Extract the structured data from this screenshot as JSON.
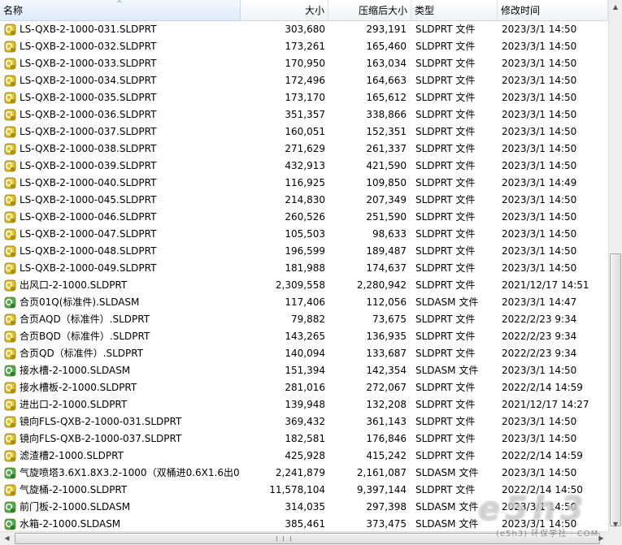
{
  "columns": {
    "name": "名称",
    "size": "大小",
    "compressed_size": "压缩后大小",
    "type": "类型",
    "modified": "修改时间"
  },
  "files": [
    {
      "name": "LS-QXB-2-1000-031.SLDPRT",
      "size": "303,680",
      "compressed": "293,191",
      "type": "SLDPRT 文件",
      "modified": "2023/3/1 14:50",
      "icon": "sldprt-icon"
    },
    {
      "name": "LS-QXB-2-1000-032.SLDPRT",
      "size": "173,261",
      "compressed": "165,460",
      "type": "SLDPRT 文件",
      "modified": "2023/3/1 14:50",
      "icon": "sldprt-icon"
    },
    {
      "name": "LS-QXB-2-1000-033.SLDPRT",
      "size": "170,950",
      "compressed": "163,034",
      "type": "SLDPRT 文件",
      "modified": "2023/3/1 14:50",
      "icon": "sldprt-icon"
    },
    {
      "name": "LS-QXB-2-1000-034.SLDPRT",
      "size": "172,496",
      "compressed": "164,663",
      "type": "SLDPRT 文件",
      "modified": "2023/3/1 14:50",
      "icon": "sldprt-icon"
    },
    {
      "name": "LS-QXB-2-1000-035.SLDPRT",
      "size": "173,170",
      "compressed": "165,612",
      "type": "SLDPRT 文件",
      "modified": "2023/3/1 14:50",
      "icon": "sldprt-icon"
    },
    {
      "name": "LS-QXB-2-1000-036.SLDPRT",
      "size": "351,357",
      "compressed": "338,866",
      "type": "SLDPRT 文件",
      "modified": "2023/3/1 14:50",
      "icon": "sldprt-icon"
    },
    {
      "name": "LS-QXB-2-1000-037.SLDPRT",
      "size": "160,051",
      "compressed": "152,351",
      "type": "SLDPRT 文件",
      "modified": "2023/3/1 14:50",
      "icon": "sldprt-icon"
    },
    {
      "name": "LS-QXB-2-1000-038.SLDPRT",
      "size": "271,629",
      "compressed": "261,337",
      "type": "SLDPRT 文件",
      "modified": "2023/3/1 14:50",
      "icon": "sldprt-icon"
    },
    {
      "name": "LS-QXB-2-1000-039.SLDPRT",
      "size": "432,913",
      "compressed": "421,590",
      "type": "SLDPRT 文件",
      "modified": "2023/3/1 14:50",
      "icon": "sldprt-icon"
    },
    {
      "name": "LS-QXB-2-1000-040.SLDPRT",
      "size": "116,925",
      "compressed": "109,850",
      "type": "SLDPRT 文件",
      "modified": "2023/3/1 14:49",
      "icon": "sldprt-icon"
    },
    {
      "name": "LS-QXB-2-1000-045.SLDPRT",
      "size": "214,830",
      "compressed": "207,349",
      "type": "SLDPRT 文件",
      "modified": "2023/3/1 14:50",
      "icon": "sldprt-icon"
    },
    {
      "name": "LS-QXB-2-1000-046.SLDPRT",
      "size": "260,526",
      "compressed": "251,590",
      "type": "SLDPRT 文件",
      "modified": "2023/3/1 14:50",
      "icon": "sldprt-icon"
    },
    {
      "name": "LS-QXB-2-1000-047.SLDPRT",
      "size": "105,503",
      "compressed": "98,633",
      "type": "SLDPRT 文件",
      "modified": "2023/3/1 14:50",
      "icon": "sldprt-icon"
    },
    {
      "name": "LS-QXB-2-1000-048.SLDPRT",
      "size": "196,599",
      "compressed": "189,487",
      "type": "SLDPRT 文件",
      "modified": "2023/3/1 14:50",
      "icon": "sldprt-icon"
    },
    {
      "name": "LS-QXB-2-1000-049.SLDPRT",
      "size": "181,988",
      "compressed": "174,637",
      "type": "SLDPRT 文件",
      "modified": "2023/3/1 14:50",
      "icon": "sldprt-icon"
    },
    {
      "name": "出风口-2-1000.SLDPRT",
      "size": "2,309,558",
      "compressed": "2,280,942",
      "type": "SLDPRT 文件",
      "modified": "2021/12/17 14:51",
      "icon": "sldprt-icon"
    },
    {
      "name": "合页01Q(标准件).SLDASM",
      "size": "117,406",
      "compressed": "112,056",
      "type": "SLDASM 文件",
      "modified": "2023/3/1 14:47",
      "icon": "sldasm-icon"
    },
    {
      "name": "合页AQD（标准件）.SLDPRT",
      "size": "79,882",
      "compressed": "73,675",
      "type": "SLDPRT 文件",
      "modified": "2022/2/23 9:34",
      "icon": "sldprt-icon"
    },
    {
      "name": "合页BQD（标准件）.SLDPRT",
      "size": "143,265",
      "compressed": "136,935",
      "type": "SLDPRT 文件",
      "modified": "2022/2/23 9:34",
      "icon": "sldprt-icon"
    },
    {
      "name": "合页QD（标准件）.SLDPRT",
      "size": "140,094",
      "compressed": "133,687",
      "type": "SLDPRT 文件",
      "modified": "2022/2/23 9:34",
      "icon": "sldprt-icon"
    },
    {
      "name": "接水槽-2-1000.SLDASM",
      "size": "151,394",
      "compressed": "142,354",
      "type": "SLDASM 文件",
      "modified": "2023/3/1 14:50",
      "icon": "sldasm-icon"
    },
    {
      "name": "接水槽板-2-1000.SLDPRT",
      "size": "281,016",
      "compressed": "272,067",
      "type": "SLDPRT 文件",
      "modified": "2022/2/14 14:59",
      "icon": "sldprt-icon"
    },
    {
      "name": "进出口-2-1000.SLDPRT",
      "size": "139,948",
      "compressed": "132,208",
      "type": "SLDPRT 文件",
      "modified": "2021/12/17 14:27",
      "icon": "sldprt-icon"
    },
    {
      "name": "镜向FLS-QXB-2-1000-031.SLDPRT",
      "size": "369,432",
      "compressed": "361,143",
      "type": "SLDPRT 文件",
      "modified": "2023/3/1 14:50",
      "icon": "sldprt-icon"
    },
    {
      "name": "镜向FLS-QXB-2-1000-037.SLDPRT",
      "size": "182,581",
      "compressed": "176,846",
      "type": "SLDPRT 文件",
      "modified": "2023/3/1 14:50",
      "icon": "sldprt-icon"
    },
    {
      "name": "滤渣槽2-1000.SLDPRT",
      "size": "425,928",
      "compressed": "415,242",
      "type": "SLDPRT 文件",
      "modified": "2022/2/14 14:59",
      "icon": "sldprt-icon"
    },
    {
      "name": "气旋喷塔3.6X1.8X3.2-1000（双桶进0.6X1.6出0....",
      "size": "2,241,879",
      "compressed": "2,161,087",
      "type": "SLDASM 文件",
      "modified": "2023/3/1 14:50",
      "icon": "sldasm-icon"
    },
    {
      "name": "气旋桶-2-1000.SLDPRT",
      "size": "11,578,104",
      "compressed": "9,397,144",
      "type": "SLDPRT 文件",
      "modified": "2022/2/14 14:50",
      "icon": "sldprt-icon"
    },
    {
      "name": "前门板-2-1000.SLDASM",
      "size": "314,035",
      "compressed": "297,398",
      "type": "SLDASM 文件",
      "modified": "2023/3/1 14:50",
      "icon": "sldasm-icon"
    },
    {
      "name": "水箱-2-1000.SLDASM",
      "size": "385,461",
      "compressed": "373,475",
      "type": "SLDASM 文件",
      "modified": "2023/3/1 14:50",
      "icon": "sldasm-icon"
    }
  ],
  "watermark": {
    "logo": "e5h3",
    "caption": "(e5h3) 环保学社 · COM"
  },
  "colors": {
    "sldprt_icon": "#e8c11c",
    "sldasm_icon": "#4caf50",
    "header_sorted": "#dcebfc"
  }
}
